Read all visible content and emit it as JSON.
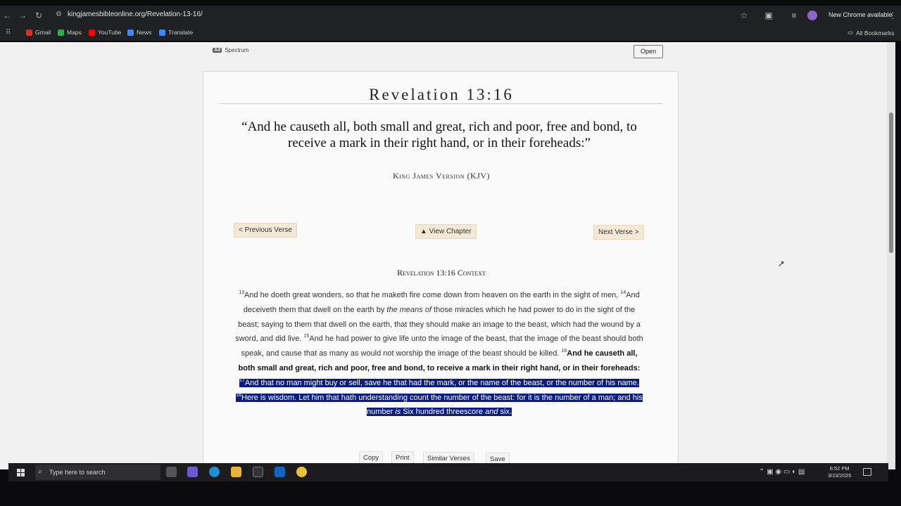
{
  "browser": {
    "url": "kingjamesbibleonline.org/Revelation-13-16/",
    "new_chrome_label": "New Chrome available",
    "bookmarks": [
      {
        "label": "Gmail",
        "color": "#d93025"
      },
      {
        "label": "Maps",
        "color": "#34a853"
      },
      {
        "label": "YouTube",
        "color": "#ff0000"
      },
      {
        "label": "News",
        "color": "#4285f4"
      },
      {
        "label": "Translate",
        "color": "#4285f4"
      }
    ],
    "all_bookmarks_label": "All Bookmarks",
    "icons": [
      "back-icon",
      "forward-icon",
      "reload-icon",
      "tune-icon",
      "star-icon",
      "extensions-icon",
      "tab-search-icon",
      "profile-icon",
      "menu-icon"
    ]
  },
  "ad": {
    "badge": "Ad",
    "label": "Spectrum",
    "open_label": "Open"
  },
  "verse": {
    "title": "Revelation 13:16",
    "quote": "“And he causeth all, both small and great, rich and poor, free and bond, to receive a mark in their right hand, or in their foreheads:”",
    "version": "King James Version (KJV)"
  },
  "navigation": {
    "previous_label": "< Previous Verse",
    "view_chapter_label": "▲ View Chapter",
    "next_label": "Next Verse >"
  },
  "context": {
    "title": "Revelation 13:16 Context",
    "v13_num": "13",
    "v13_text": "And he doeth great wonders, so that he maketh fire come down from heaven on the earth in the sight of men, ",
    "v14_num": "14",
    "v14_text_a": "And deceiveth them that dwell on the earth by ",
    "v14_italic": "the means of",
    "v14_text_b": " those miracles which he had power to do in the sight of the beast; saying to them that dwell on the earth, that they should make an image to the beast, which had the wound by a sword, and did live. ",
    "v15_num": "15",
    "v15_text": "And he had power to give life unto the image of the beast, that the image of the beast should both speak, and cause that as many as would not worship the image of the beast should be killed. ",
    "v16_num": "16",
    "v16_text": "And he causeth all, both small and great, rich and poor, free and bond, to receive a mark in their right hand, or in their foreheads:",
    "v17_num": "17",
    "v17_text": "And that no man might buy or sell, save he that had the mark, or the name of the beast, or the number of his name. ",
    "v18_num": "18",
    "v18_text_a": "Here is wisdom. Let him that hath understanding count the number of the beast: for it is the number of a man; and his number ",
    "v18_italic_1": "is",
    "v18_text_b": " Six hundred threescore ",
    "v18_italic_2": "and",
    "v18_text_c": " six."
  },
  "tools": {
    "copy_label": "Copy",
    "print_label": "Print",
    "similar_label": "Similar Verses",
    "save_label": "Save"
  },
  "taskbar": {
    "search_placeholder": "Type here to search",
    "time": "6:52 PM",
    "date": "3/23/2025"
  }
}
